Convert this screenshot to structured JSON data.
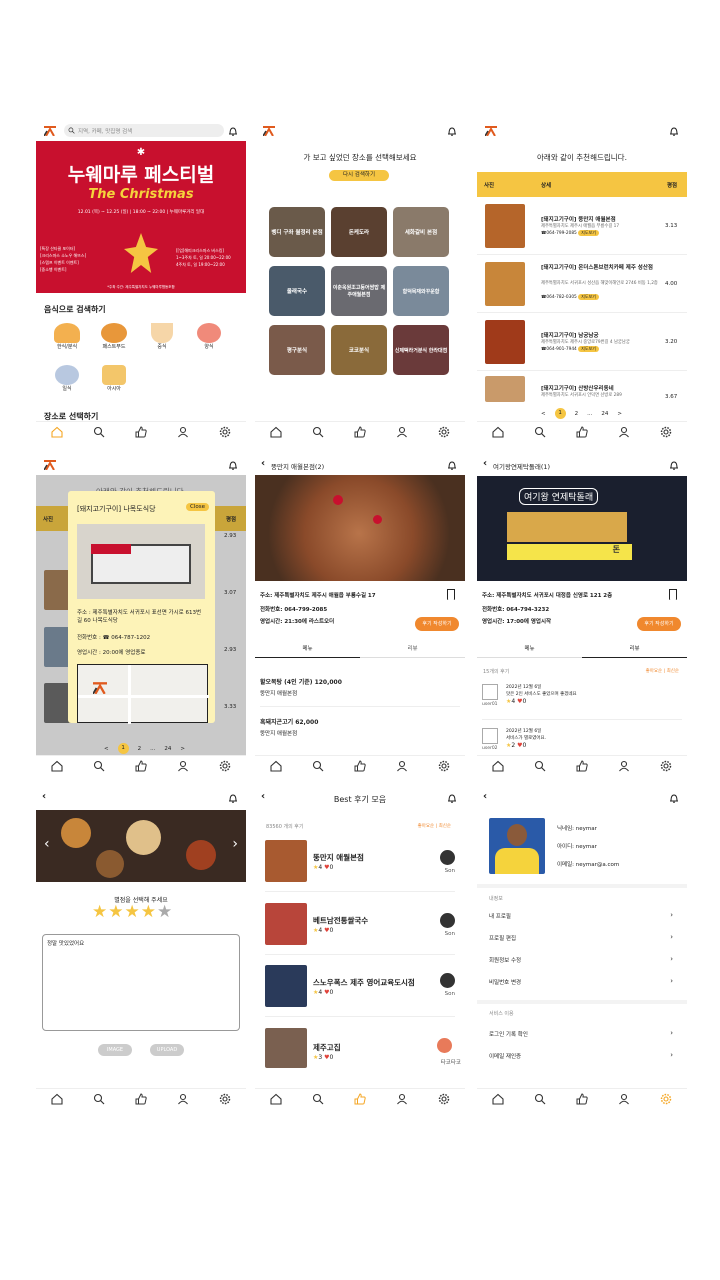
{
  "s1": {
    "search_placeholder": "지역, 카페, 맛집명 검색",
    "banner_title": "누웨마루 페스티벌",
    "banner_sub": "The Christmas",
    "banner_date": "12.01 (목) ~ 12.25 (일) | 18:00 ~ 22:00 | 누웨마루거리 일대",
    "banner_left": "[특장 산타클 포이터]\n[크리스마스 소노우 해뜨스]\n[스탬프 이벤트 이벤트]\n[중소행 이벤트]",
    "banner_right": "[[업]해피크리스마스 버스킹]\n1~3주차 토, 일 20:00~22:00\n4주차 토, 일 19:00~22:00",
    "banner_small": "*주최·주관: 제주특별자치도 누웨마루협동조합",
    "food_title": "음식으로 검색하기",
    "foods": [
      "한식/분식",
      "패스트푸드",
      "중식",
      "양식",
      "일식",
      "아시아"
    ],
    "place_title": "장소로 선택하기"
  },
  "s2": {
    "title": "가 보고 싶었던 장소를 선택해보세요",
    "retry": "다시 검색하기",
    "places": [
      "벵디 구좌 월정리 본점",
      "돈케도라",
      "세화갈비 본점",
      "올래국수",
      "이춘옥원조고등어쌈밥 제주애월본점",
      "함덕목재와꾸운함",
      "평구분식",
      "코코분식",
      "신제떡라거분식 한라대점"
    ]
  },
  "s3": {
    "title": "아래와 같이 추천해드립니다.",
    "cols": [
      "사진",
      "상세",
      "평점"
    ],
    "rows": [
      {
        "name": "[돼지고기구이] 뚱만지 애월본점",
        "addr": "제주특별자치도 제주시 애월읍 부룡수길 17",
        "tel": "☎064-799-2085",
        "score": "3.13"
      },
      {
        "name": "[돼지고기구이] 온더스톤브런치카페 제주 성산점",
        "addr": "제주특별자치도 서귀포시 성산읍 해맞이해안로 2746 비동 1,2층",
        "tel": "☎064-782-0305",
        "score": "4.00"
      },
      {
        "name": "[돼지고기구이] 남궁남궁",
        "addr": "제주특별자치도 제주시 중앙로79번길 4 남궁남궁",
        "tel": "☎064-901-7944",
        "score": "3.20"
      },
      {
        "name": "[돼지고기구이] 산방산우리동네",
        "addr": "제주특별자치도 서귀포시 안덕면 산방로 289",
        "tel": "",
        "score": "3.67"
      }
    ],
    "map_btn": "지도보기",
    "pages": [
      "<",
      "1",
      "2",
      "...",
      "24",
      ">"
    ]
  },
  "s4": {
    "popup_title": "[돼지고기구이] 나목도식당",
    "close": "Close",
    "addr": "주소 : 제주특별자치도 서귀포시 표선면 가시로 613번길 60 나목도식당",
    "tel": "전화번호 : ☎ 064-787-1202",
    "hours": "영업시간 : 20:00에 영업종료",
    "scores": [
      "2.93",
      "3.07",
      "2.93",
      "3.33"
    ],
    "pages": [
      "<",
      "1",
      "2",
      "...",
      "24",
      ">"
    ],
    "bg_title": "아래와 같이 추천해드립니다.",
    "cols": [
      "사진",
      "평점"
    ]
  },
  "s5": {
    "title": "뚱만지 애월본점(2)",
    "addr": "주소: 제주특별자치도 제주시 애월읍 부룡수길 17",
    "tel": "전화번호: 064-799-2085",
    "hours": "영업시간: 21:30에 라스트오더",
    "review_btn": "후기 작성하기",
    "tabs": [
      "메뉴",
      "리뷰"
    ],
    "menu": [
      {
        "name": "할오복탕 (4인 기준) 120,000",
        "store": "뚱만지 애월본점"
      },
      {
        "name": "흑돼지곤고기 62,000",
        "store": "뚱만지 애월본점"
      }
    ]
  },
  "s6": {
    "title": "여기왕연제탁돌래(1)",
    "sign": "여기왕 연제탁돌래",
    "sign2": "돈",
    "addr": "주소: 제주특별자치도 서귀포시 대정읍 신영로 121 2층",
    "tel": "전화번호: 064-794-3232",
    "hours": "영업시간: 17:00에 영업시작",
    "review_btn": "후기 작성하기",
    "tabs": [
      "메뉴",
      "리뷰"
    ],
    "count": "15개의 후기",
    "sort": "좋아요순 | 최신순",
    "reviews": [
      {
        "user": "user01",
        "date": "2022년 12월 6일",
        "text": "맛은 2인 서비스도 좋았으며 좋겠네요",
        "stars": "4",
        "likes": "0"
      },
      {
        "user": "user02",
        "date": "2022년 12월 6일",
        "text": "서비스가 별로였어요.",
        "stars": "2",
        "likes": "0"
      }
    ]
  },
  "s7": {
    "prompt": "별점을 선택해 주세요",
    "text": "정말 맛있었어요",
    "image": "IMAGE",
    "upload": "UPLOAD"
  },
  "s8": {
    "title": "Best 후기 모음",
    "count": "83560 개의 후기",
    "sort": "좋아요순 | 최신순",
    "items": [
      {
        "name": "뚱만지 애월본점",
        "stars": "4",
        "likes": "0",
        "user": "Son"
      },
      {
        "name": "베트남전통쌀국수",
        "stars": "4",
        "likes": "0",
        "user": "Son"
      },
      {
        "name": "스노우폭스 제주 영어교육도시점",
        "stars": "4",
        "likes": "0",
        "user": "Son"
      },
      {
        "name": "제주고집",
        "stars": "3",
        "likes": "0",
        "user": "타코타코"
      }
    ]
  },
  "s9": {
    "nick": "닉네임: neymar",
    "id": "아이디: neymar",
    "email": "이메일: neymar@a.com",
    "sec1": "내정보",
    "menu1": [
      "내 프로필",
      "프로필 편집",
      "회원정보 수정",
      "비밀번호 변경"
    ],
    "sec2": "서비스 이용",
    "menu2": [
      "로그인 기록 확인",
      "이메일 재인증"
    ]
  },
  "colors": {
    "accent": "#f5c542",
    "brand_red": "#c8102e",
    "nav_active": "#f5a623",
    "button_orange": "#f0882e"
  }
}
